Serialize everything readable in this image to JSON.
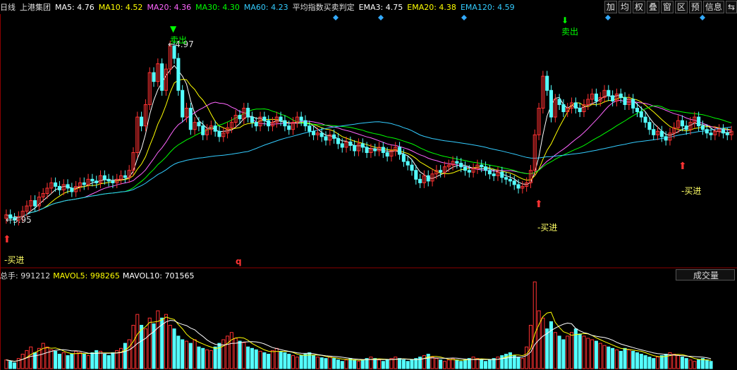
{
  "header": {
    "period": "日线",
    "stock": "上港集团",
    "ma": [
      {
        "label": "MA5: 4.76",
        "color": "#ffffff"
      },
      {
        "label": "MA10: 4.52",
        "color": "#ffff00"
      },
      {
        "label": "MA20: 4.36",
        "color": "#ff66ff"
      },
      {
        "label": "MA30: 4.30",
        "color": "#00ff00"
      },
      {
        "label": "MA60: 4.23",
        "color": "#33ccff"
      }
    ],
    "indicator": "平均指数买卖判定",
    "ema": [
      {
        "label": "EMA3: 4.75",
        "color": "#ffffff"
      },
      {
        "label": "EMA20: 4.38",
        "color": "#ffff00"
      },
      {
        "label": "EMA120: 4.59",
        "color": "#33ccff"
      }
    ]
  },
  "toolbar": [
    "加",
    "均",
    "权",
    "叠",
    "窗",
    "区",
    "预",
    "信息",
    "⇆"
  ],
  "volume_header": {
    "total": "总手: 991212",
    "mavol5": "MAVOL5: 998265",
    "mavol10": "MAVOL10: 701565",
    "selector": "成交量"
  },
  "annotations": {
    "high_label": "4.97",
    "low_label": "3.95",
    "sell": "卖出",
    "buy": "买进",
    "q_marker": "q"
  },
  "chart_data": [
    {
      "type": "candlestick",
      "title": "日线 上港集团",
      "price_high": 4.97,
      "price_low": 3.95,
      "sell_signals_index": [
        40,
        134
      ],
      "buy_signals_index": [
        0,
        127,
        162
      ],
      "close": [
        4.0,
        3.98,
        3.97,
        3.99,
        4.02,
        4.05,
        4.08,
        4.05,
        4.1,
        4.12,
        4.15,
        4.18,
        4.16,
        4.14,
        4.17,
        4.15,
        4.13,
        4.16,
        4.18,
        4.17,
        4.2,
        4.19,
        4.18,
        4.22,
        4.2,
        4.19,
        4.18,
        4.2,
        4.22,
        4.21,
        4.25,
        4.35,
        4.55,
        4.5,
        4.62,
        4.8,
        4.75,
        4.85,
        4.7,
        4.82,
        4.95,
        4.88,
        4.7,
        4.55,
        4.6,
        4.48,
        4.52,
        4.5,
        4.45,
        4.48,
        4.5,
        4.47,
        4.44,
        4.46,
        4.49,
        4.52,
        4.56,
        4.54,
        4.6,
        4.55,
        4.52,
        4.5,
        4.55,
        4.53,
        4.5,
        4.52,
        4.55,
        4.53,
        4.5,
        4.48,
        4.52,
        4.55,
        4.53,
        4.5,
        4.47,
        4.45,
        4.46,
        4.44,
        4.42,
        4.45,
        4.43,
        4.4,
        4.38,
        4.41,
        4.39,
        4.36,
        4.4,
        4.38,
        4.35,
        4.37,
        4.36,
        4.38,
        4.35,
        4.33,
        4.36,
        4.38,
        4.34,
        4.3,
        4.28,
        4.25,
        4.2,
        4.18,
        4.22,
        4.19,
        4.23,
        4.25,
        4.24,
        4.27,
        4.28,
        4.3,
        4.29,
        4.27,
        4.25,
        4.24,
        4.26,
        4.28,
        4.27,
        4.25,
        4.23,
        4.22,
        4.24,
        4.21,
        4.2,
        4.19,
        4.17,
        4.15,
        4.16,
        4.18,
        4.25,
        4.45,
        4.6,
        4.78,
        4.7,
        4.55,
        4.65,
        4.62,
        4.58,
        4.6,
        4.63,
        4.6,
        4.58,
        4.62,
        4.65,
        4.68,
        4.64,
        4.66,
        4.7,
        4.67,
        4.64,
        4.68,
        4.66,
        4.62,
        4.65,
        4.6,
        4.58,
        4.55,
        4.52,
        4.48,
        4.45,
        4.47,
        4.44,
        4.42,
        4.46,
        4.49,
        4.53,
        4.5,
        4.48,
        4.52,
        4.55,
        4.5,
        4.48,
        4.46,
        4.45,
        4.47,
        4.48,
        4.46,
        4.45,
        4.47
      ]
    },
    {
      "type": "bar",
      "title": "成交量",
      "values": [
        12,
        10,
        8,
        14,
        20,
        25,
        30,
        22,
        28,
        35,
        30,
        26,
        24,
        20,
        22,
        18,
        20,
        24,
        22,
        20,
        18,
        22,
        25,
        24,
        20,
        18,
        22,
        25,
        28,
        35,
        40,
        60,
        75,
        60,
        55,
        70,
        62,
        80,
        70,
        75,
        60,
        55,
        45,
        40,
        38,
        35,
        40,
        30,
        28,
        26,
        25,
        30,
        35,
        40,
        45,
        50,
        42,
        38,
        36,
        30,
        28,
        26,
        24,
        22,
        20,
        25,
        28,
        24,
        22,
        20,
        18,
        16,
        18,
        20,
        22,
        18,
        16,
        15,
        14,
        16,
        14,
        12,
        10,
        12,
        14,
        12,
        10,
        12,
        14,
        16,
        14,
        12,
        10,
        12,
        14,
        16,
        14,
        12,
        10,
        12,
        14,
        16,
        18,
        20,
        16,
        14,
        12,
        10,
        12,
        14,
        12,
        10,
        12,
        14,
        16,
        14,
        12,
        10,
        12,
        14,
        16,
        18,
        20,
        22,
        18,
        16,
        14,
        30,
        60,
        120,
        80,
        70,
        55,
        65,
        50,
        45,
        40,
        45,
        50,
        55,
        48,
        45,
        42,
        40,
        38,
        35,
        32,
        30,
        28,
        26,
        24,
        28,
        26,
        24,
        22,
        20,
        18,
        16,
        14,
        16,
        18,
        20,
        22,
        20,
        18,
        16,
        14,
        12,
        10,
        12,
        14,
        12,
        10
      ],
      "mavol5": 998265,
      "mavol10": 701565
    }
  ]
}
